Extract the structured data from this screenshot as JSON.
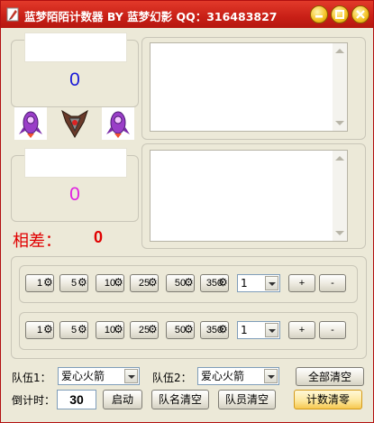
{
  "window": {
    "title": "蓝梦陌陌计数器 BY 蓝梦幻影 QQ：316483827",
    "controls": [
      "minimize",
      "maximize",
      "close"
    ]
  },
  "team1": {
    "count": "0",
    "count_color": "#1a1ad8",
    "side_icon": "rocket-icon"
  },
  "team2": {
    "count": "0",
    "count_color": "#e020e0",
    "side_icon": "rocket-icon"
  },
  "center_icon": "shield-emblem-icon",
  "difference": {
    "label": "相差：",
    "value": "0"
  },
  "increment_rows": [
    {
      "buttons": [
        "1",
        "5",
        "10",
        "25",
        "50",
        "350"
      ],
      "multiplier": "1",
      "plus": "+",
      "minus": "-"
    },
    {
      "buttons": [
        "1",
        "5",
        "10",
        "25",
        "50",
        "350"
      ],
      "multiplier": "1",
      "plus": "+",
      "minus": "-"
    }
  ],
  "bottom": {
    "team1_label": "队伍1：",
    "team1_value": "爱心火箭",
    "team2_label": "队伍2：",
    "team2_value": "爱心火箭",
    "clear_all": "全部清空",
    "countdown_label": "倒计时：",
    "countdown_value": "30",
    "start": "启动",
    "clear_team_names": "队名清空",
    "clear_members": "队员清空",
    "reset_counts": "计数清零"
  },
  "colors": {
    "title_bar": "#c81f16",
    "difference": "#e00000",
    "highlight_button": "#fde8a0"
  }
}
